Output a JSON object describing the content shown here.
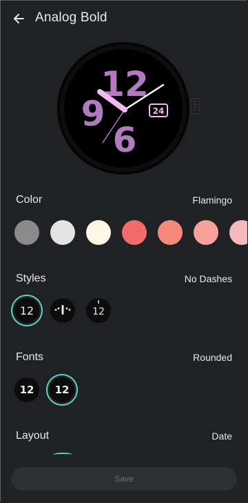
{
  "header": {
    "title": "Analog Bold",
    "back_icon": "arrow-left-icon"
  },
  "watch_face": {
    "numerals": [
      "12",
      "9",
      "6"
    ],
    "date": "24",
    "accent_color": "#b27bbf",
    "hand_color": "#f1b9f4"
  },
  "color_section": {
    "label": "Color",
    "value": "Flamingo",
    "swatches": [
      "#8a8a8a",
      "#e3e3e3",
      "#fcf6e6",
      "#f36c6c",
      "#f6897b",
      "#f7a09c",
      "#f5b9bc"
    ]
  },
  "styles_section": {
    "label": "Styles",
    "value": "No Dashes",
    "options": [
      "12",
      "",
      "12"
    ]
  },
  "fonts_section": {
    "label": "Fonts",
    "value": "Rounded",
    "options": [
      "12",
      "12"
    ]
  },
  "layout_section": {
    "label": "Layout",
    "value": "Date"
  },
  "footer": {
    "save_label": "Save"
  },
  "colors": {
    "background": "#202124",
    "selected_ring": "#5bd3c7"
  }
}
